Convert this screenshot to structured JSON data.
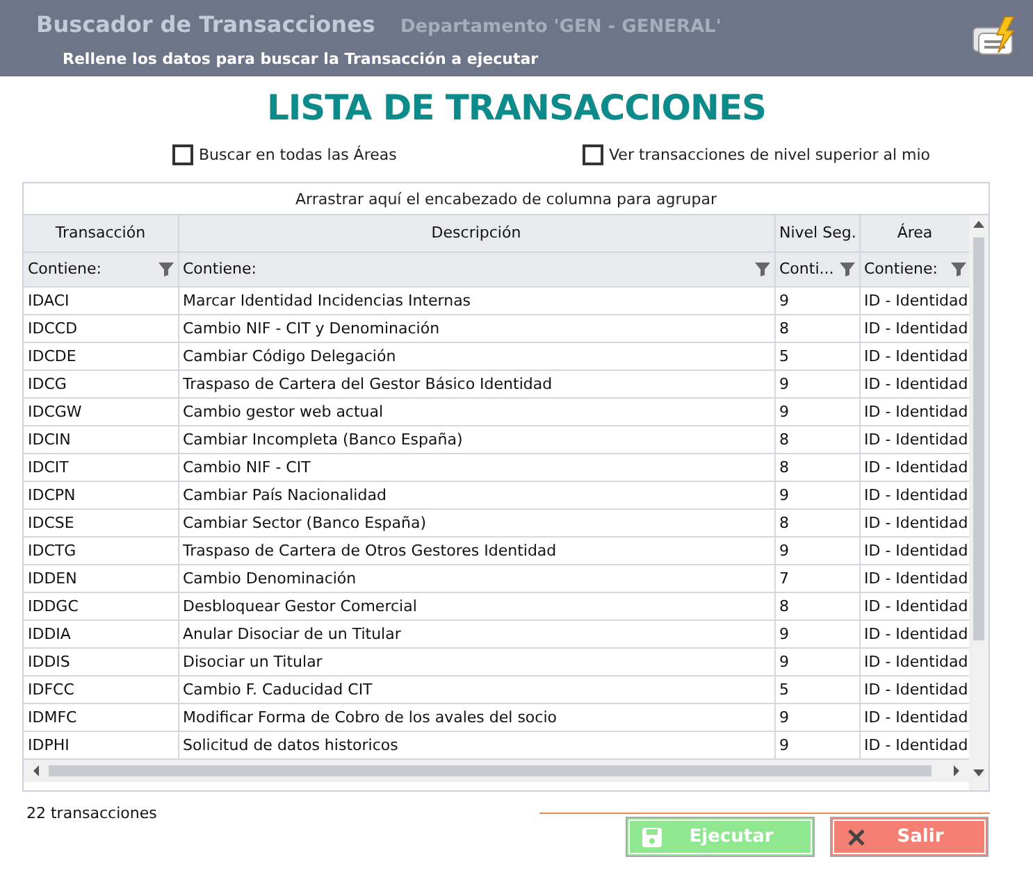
{
  "header": {
    "title": "Buscador de Transacciones",
    "department": "Departamento 'GEN - GENERAL'",
    "subtitle": "Rellene los datos para buscar la Transacción a ejecutar"
  },
  "heading": "LISTA DE TRANSACCIONES",
  "options": [
    {
      "label": "Buscar en todas las Áreas",
      "checked": false
    },
    {
      "label": "Ver transacciones de nivel superior al mio",
      "checked": false
    }
  ],
  "grid": {
    "group_panel": "Arrastrar aquí el encabezado de columna para agrupar",
    "columns": [
      {
        "label": "Transacción",
        "filter": "Contiene:"
      },
      {
        "label": "Descripción",
        "filter": "Contiene:"
      },
      {
        "label": "Nivel Seg.",
        "filter": "Conti..."
      },
      {
        "label": "Área",
        "filter": "Contiene:"
      }
    ],
    "rows": [
      [
        "IDACI",
        "Marcar Identidad Incidencias Internas",
        "9",
        "ID - Identidad"
      ],
      [
        "IDCCD",
        "Cambio NIF - CIT y Denominación",
        "8",
        "ID - Identidad"
      ],
      [
        "IDCDE",
        "Cambiar Código Delegación",
        "5",
        "ID - Identidad"
      ],
      [
        "IDCG",
        "Traspaso de Cartera del Gestor Básico Identidad",
        "9",
        "ID - Identidad"
      ],
      [
        "IDCGW",
        "Cambio gestor web actual",
        "9",
        "ID - Identidad"
      ],
      [
        "IDCIN",
        "Cambiar Incompleta (Banco España)",
        "8",
        "ID - Identidad"
      ],
      [
        "IDCIT",
        "Cambio NIF - CIT",
        "8",
        "ID - Identidad"
      ],
      [
        "IDCPN",
        "Cambiar País Nacionalidad",
        "9",
        "ID - Identidad"
      ],
      [
        "IDCSE",
        "Cambiar Sector (Banco España)",
        "8",
        "ID - Identidad"
      ],
      [
        "IDCTG",
        "Traspaso de Cartera de Otros Gestores Identidad",
        "9",
        "ID - Identidad"
      ],
      [
        "IDDEN",
        "Cambio Denominación",
        "7",
        "ID - Identidad"
      ],
      [
        "IDDGC",
        "Desbloquear Gestor Comercial",
        "8",
        "ID - Identidad"
      ],
      [
        "IDDIA",
        "Anular Disociar de un Titular",
        "9",
        "ID - Identidad"
      ],
      [
        "IDDIS",
        "Disociar un Titular",
        "9",
        "ID - Identidad"
      ],
      [
        "IDFCC",
        "Cambio F. Caducidad CIT",
        "5",
        "ID - Identidad"
      ],
      [
        "IDMFC",
        "Modificar Forma de Cobro de los avales del socio",
        "9",
        "ID - Identidad"
      ],
      [
        "IDPHI",
        "Solicitud de datos historicos",
        "9",
        "ID - Identidad"
      ]
    ]
  },
  "count": "22 transacciones",
  "buttons": [
    {
      "label": "Ejecutar",
      "kind": "execute"
    },
    {
      "label": "Salir",
      "kind": "exit"
    }
  ]
}
